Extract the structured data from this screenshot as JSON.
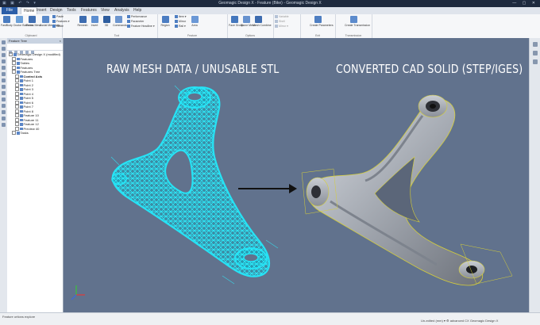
{
  "window": {
    "title": "Geomagic Design X - Feature (Bike)  -  Geomagic Design X",
    "quick_access": "▣ ▣ ↶ ↷ ▾",
    "controls": "—  ▢  ✕"
  },
  "menu": {
    "file": "File",
    "items": [
      "Home",
      "Insert",
      "Design",
      "Tools",
      "Features",
      "View",
      "Analysis",
      "Help"
    ]
  },
  "ribbon": {
    "groups": [
      {
        "label": "Clipboard",
        "buttons": [
          "FastBody",
          "Doctor Batteries",
          "Focus Mesh",
          "Assist Meshlogic"
        ]
      },
      {
        "label": "Tool",
        "buttons": [
          "Remesh",
          "Invert",
          "3D",
          "Commands"
        ]
      },
      {
        "label": "Feature",
        "buttons": [
          "Region",
          "Area"
        ]
      },
      {
        "label": "Options",
        "buttons": [
          "Face Group",
          "Stone Mesh",
          "Mesh Combine"
        ]
      },
      {
        "label": "Exit",
        "buttons": [
          "Create Parameters"
        ]
      },
      {
        "label": "Transmission",
        "buttons": [
          "Create Transmission"
        ]
      }
    ],
    "small_items": [
      "Paste",
      "Features ▾",
      "Paste",
      "Performance",
      "Parameter",
      "Feature Headline ▾",
      "Item ▾",
      "Mirror",
      "Rail ▾",
      "Variable",
      "Shell",
      "Project",
      "Mirror ▾"
    ]
  },
  "feature_tree": {
    "title": "Feature Tree",
    "items": [
      {
        "label": "Geomagic Design X (modified)",
        "level": 0,
        "bold": false
      },
      {
        "label": "Features",
        "level": 1,
        "bold": false
      },
      {
        "label": "Tables",
        "level": 1,
        "bold": false
      },
      {
        "label": "Features",
        "level": 1,
        "bold": false
      },
      {
        "label": "Features Tree",
        "level": 1,
        "bold": false
      },
      {
        "label": "Control Axis",
        "level": 2,
        "bold": true
      },
      {
        "label": "Point 1",
        "level": 2,
        "bold": false
      },
      {
        "label": "Point 2",
        "level": 2,
        "bold": false
      },
      {
        "label": "Point 3",
        "level": 2,
        "bold": false
      },
      {
        "label": "Point 4",
        "level": 2,
        "bold": false
      },
      {
        "label": "Point 5",
        "level": 2,
        "bold": false
      },
      {
        "label": "Point 6",
        "level": 2,
        "bold": false
      },
      {
        "label": "Point 7",
        "level": 2,
        "bold": false
      },
      {
        "label": "Point 8",
        "level": 2,
        "bold": false
      },
      {
        "label": "Feature 10",
        "level": 2,
        "bold": false
      },
      {
        "label": "Feature 11",
        "level": 2,
        "bold": false
      },
      {
        "label": "Feature 12",
        "level": 2,
        "bold": false
      },
      {
        "label": "Preview 40",
        "level": 2,
        "bold": false
      },
      {
        "label": "Tasks",
        "level": 1,
        "bold": false
      }
    ]
  },
  "viewport": {
    "left_caption": "RAW MESH DATA / UNUSABLE STL",
    "right_caption": "CONVERTED CAD SOLID (STEP/IGES)",
    "mesh_color": "#19d3e6",
    "background": "#61728d"
  },
  "statusbar": {
    "left_tab": "Feature ortions explore",
    "right_text": "Un-edited (mm) ▾     ⚙ advanced CX Geomagic Design X"
  }
}
